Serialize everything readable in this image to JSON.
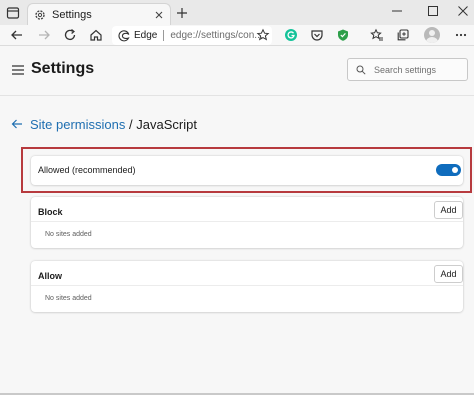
{
  "browser": {
    "tab_title": "Settings",
    "address": {
      "site_label": "Edge",
      "url": "edge://settings/con..."
    },
    "accent_color": "#0f6cbd",
    "icons": {
      "tab_actions": "tab-actions-icon",
      "tab": "gear-icon",
      "tab_close": "close-icon",
      "new_tab": "plus-icon",
      "minimize": "minimize-icon",
      "maximize": "maximize-icon",
      "close_window": "close-window-icon",
      "back": "arrow-left-icon",
      "forward": "arrow-right-icon",
      "refresh": "refresh-icon",
      "home": "home-icon",
      "favorite": "star-icon",
      "grammarly": "grammarly-icon",
      "pocket": "pocket-icon",
      "shield": "shield-icon",
      "favorites": "favorites-icon",
      "collections": "collections-icon",
      "profile": "avatar",
      "more": "more-icon"
    }
  },
  "settings": {
    "title": "Settings",
    "search_placeholder": "Search settings"
  },
  "breadcrumb": {
    "parent": "Site permissions",
    "separator": "/",
    "current": "JavaScript"
  },
  "allowed": {
    "label": "Allowed (recommended)",
    "enabled": true
  },
  "sections": {
    "block": {
      "title": "Block",
      "add_label": "Add",
      "empty_text": "No sites added"
    },
    "allow": {
      "title": "Allow",
      "add_label": "Add",
      "empty_text": "No sites added"
    }
  },
  "highlight_color": "#b73a3e"
}
